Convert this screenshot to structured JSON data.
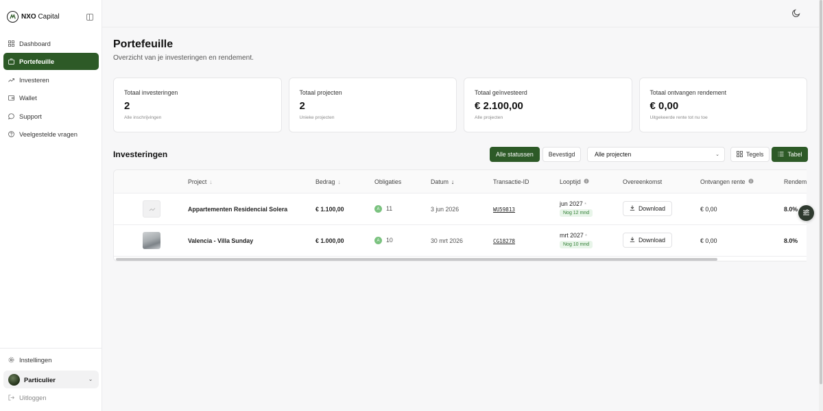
{
  "brand": {
    "bold": "NXO",
    "name": " Capital"
  },
  "sidebar": {
    "items": [
      {
        "label": "Dashboard",
        "icon": "grid-icon"
      },
      {
        "label": "Portefeuille",
        "icon": "briefcase-icon",
        "active": true
      },
      {
        "label": "Investeren",
        "icon": "trending-up-icon"
      },
      {
        "label": "Wallet",
        "icon": "wallet-icon"
      },
      {
        "label": "Support",
        "icon": "chat-icon"
      },
      {
        "label": "Veelgestelde vragen",
        "icon": "help-circle-icon"
      }
    ],
    "settings": "Instellingen",
    "account": "Particulier",
    "logout": "Uitloggen"
  },
  "page": {
    "title": "Portefeuille",
    "subtitle": "Overzicht van je investeringen en rendement."
  },
  "cards": [
    {
      "label": "Totaal investeringen",
      "value": "2",
      "note": "Alle inschrijvingen"
    },
    {
      "label": "Totaal projecten",
      "value": "2",
      "note": "Unieke projecten"
    },
    {
      "label": "Totaal geïnvesteerd",
      "value": "€ 2.100,00",
      "note": "Alle projecten"
    },
    {
      "label": "Totaal ontvangen rendement",
      "value": "€ 0,00",
      "note": "Uitgekeerde rente tot nu toe"
    }
  ],
  "investments": {
    "title": "Investeringen",
    "filters": {
      "all": "Alle statussen",
      "confirmed": "Bevestigd"
    },
    "project_select": "Alle projecten",
    "views": {
      "tiles": "Tegels",
      "table": "Tabel"
    },
    "columns": {
      "project": "Project",
      "amount": "Bedrag",
      "bonds": "Obligaties",
      "date": "Datum",
      "txid": "Transactie-ID",
      "term": "Looptijd",
      "agreement": "Overeenkomst",
      "interest": "Ontvangen rente",
      "yield": "Rendem"
    },
    "rows": [
      {
        "project": "Appartementen Residencial Solera",
        "amount": "€ 1.100,00",
        "badge": "A",
        "bonds": "11",
        "date": "3 jun 2026",
        "txid": "WU59813",
        "term": "jun 2027",
        "remaining": "Nog 12 mnd",
        "download": "Download",
        "interest": "€ 0,00",
        "yield": "8.0%"
      },
      {
        "project": "Valencia - Villa Sunday",
        "amount": "€ 1.000,00",
        "badge": "A",
        "bonds": "10",
        "date": "30 mrt 2026",
        "txid": "CG18278",
        "term": "mrt 2027",
        "remaining": "Nog 10 mnd",
        "download": "Download",
        "interest": "€ 0,00",
        "yield": "8.0%"
      }
    ]
  },
  "colors": {
    "accent": "#2d5a27",
    "badge": "#7ac27f"
  }
}
